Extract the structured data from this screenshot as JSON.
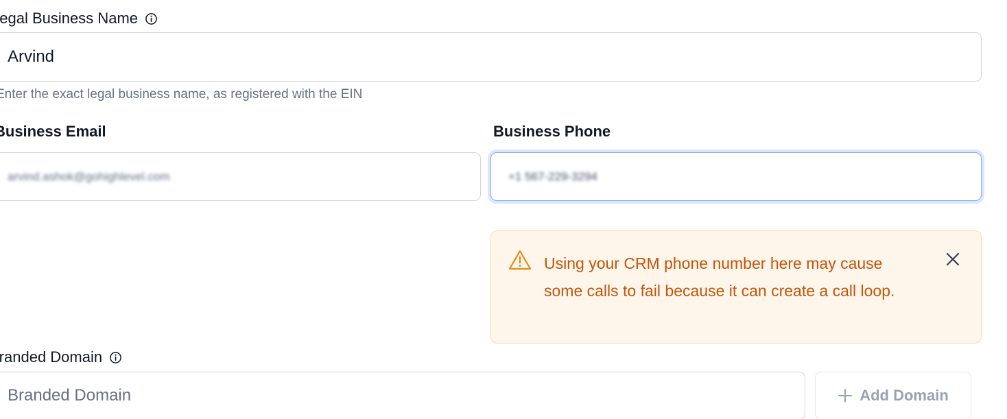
{
  "legal_business_name": {
    "label": "Legal Business Name",
    "value": "Arvind",
    "helper": "Enter the exact legal business name, as registered with the EIN"
  },
  "business_email": {
    "label": "Business Email",
    "value": "arvind.ashok@gohighlevel.com"
  },
  "business_phone": {
    "label": "Business Phone",
    "value": "+1 567-229-3294"
  },
  "warning": {
    "message": "Using your CRM phone number here may cause some calls to fail because it can create a call loop.",
    "icon": "warning-triangle-icon",
    "color": "#c4540b",
    "background": "#fef6ea"
  },
  "branded_domain": {
    "label": "Branded Domain",
    "placeholder": "Branded Domain",
    "add_button_label": "Add Domain"
  },
  "colors": {
    "focus_border": "#84adff",
    "text": "#101828",
    "muted": "#667085"
  }
}
